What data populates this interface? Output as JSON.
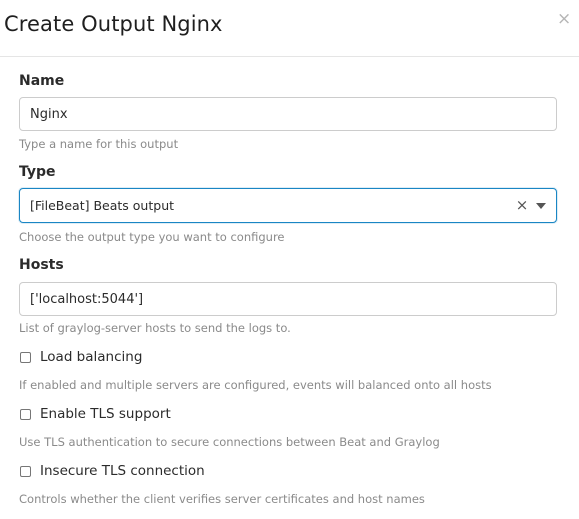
{
  "dialog": {
    "title": "Create Output Nginx",
    "close_glyph": "×"
  },
  "fields": {
    "name": {
      "label": "Name",
      "value": "Nginx",
      "help": "Type a name for this output"
    },
    "type": {
      "label": "Type",
      "selected": "[FileBeat] Beats output",
      "clear_glyph": "×",
      "help": "Choose the output type you want to configure"
    },
    "hosts": {
      "label": "Hosts",
      "value": "['localhost:5044']",
      "help": "List of graylog-server hosts to send the logs to."
    },
    "load_balancing": {
      "label": "Load balancing",
      "checked": false,
      "help": "If enabled and multiple servers are configured, events will balanced onto all hosts"
    },
    "enable_tls": {
      "label": "Enable TLS support",
      "checked": false,
      "help": "Use TLS authentication to secure connections between Beat and Graylog"
    },
    "insecure_tls": {
      "label": "Insecure TLS connection",
      "checked": false,
      "help": "Controls whether the client verifies server certificates and host names"
    }
  },
  "colors": {
    "focus_border": "#1a86c4",
    "help_text": "#8a8a8a",
    "input_border": "#cccccc"
  }
}
